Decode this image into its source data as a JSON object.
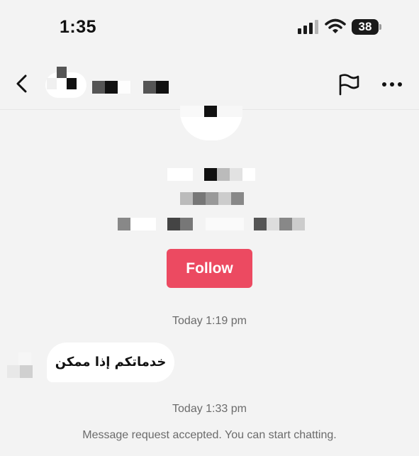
{
  "status_bar": {
    "time": "1:35",
    "battery": "38",
    "icons": [
      "signal-icon",
      "wifi-icon",
      "battery-icon"
    ]
  },
  "nav": {
    "icons": [
      "back-icon",
      "flag-icon",
      "more-icon"
    ]
  },
  "profile": {
    "follow_label": "Follow"
  },
  "conversation": {
    "timestamp_1": "Today 1:19 pm",
    "message_1": "خدماتكم إذا ممكن",
    "timestamp_2": "Today 1:33 pm",
    "system_note": "Message request accepted. You can start chatting."
  },
  "colors": {
    "background": "#f3f3f3",
    "follow_button": "#ec4a61",
    "bubble": "#ffffff",
    "secondary_text": "#6b6b6b"
  }
}
